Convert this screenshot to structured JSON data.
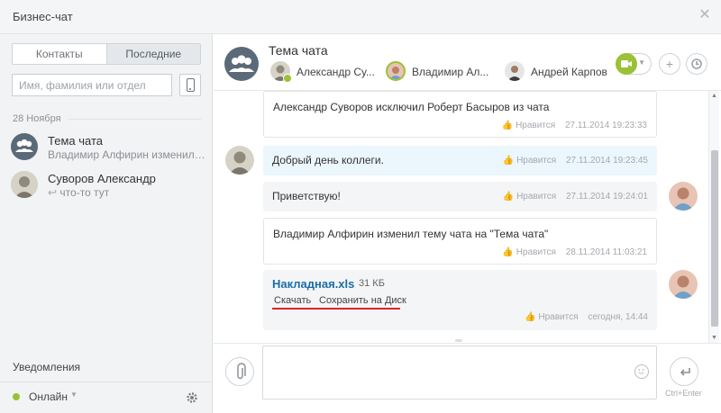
{
  "window": {
    "title": "Бизнес-чат"
  },
  "sidebar": {
    "tabs": [
      "Контакты",
      "Последние"
    ],
    "active_tab": "Последние",
    "search_placeholder": "Имя, фамилия или отдел",
    "date_separator": "28 Ноября",
    "recent": [
      {
        "name": "Тема чата",
        "subtitle": "Владимир Алфирин изменил тему ч"
      },
      {
        "name": "Суворов Александр",
        "subtitle": "что-то тут"
      }
    ],
    "notifications_label": "Уведомления",
    "status": {
      "label": "Онлайн",
      "color": "#9bc136"
    }
  },
  "chat": {
    "title": "Тема чата",
    "members": [
      "Александр Су...",
      "Владимир Ал...",
      "Андрей Карпов"
    ],
    "messages": [
      {
        "text": "Александр Суворов исключил Роберт Басыров из чата",
        "like": "Нравится",
        "time": "27.11.2014 19:23:33"
      },
      {
        "text": "Добрый день коллеги.",
        "like": "Нравится",
        "time": "27.11.2014 19:23:45"
      },
      {
        "text": "Приветствую!",
        "like": "Нравится",
        "time": "27.11.2014 19:24:01"
      },
      {
        "text": "Владимир Алфирин изменил тему чата на \"Тема чата\"",
        "like": "Нравится",
        "time": "28.11.2014 11:03:21"
      }
    ],
    "file": {
      "name": "Накладная.xls",
      "size": "31 КБ",
      "download": "Скачать",
      "save_to_disk": "Сохранить на Диск",
      "like": "Нравится",
      "time": "сегодня, 14:44"
    },
    "send_hint": "Ctrl+Enter"
  },
  "colors": {
    "accent_green": "#9bc136",
    "link_blue": "#1b6ea8",
    "highlight_red": "#e3202a"
  },
  "icons": [
    "close-icon",
    "phone-icon",
    "group-icon",
    "video-icon",
    "plus-icon",
    "history-icon",
    "attach-icon",
    "smile-icon",
    "send-icon",
    "gear-icon",
    "like-icon"
  ]
}
